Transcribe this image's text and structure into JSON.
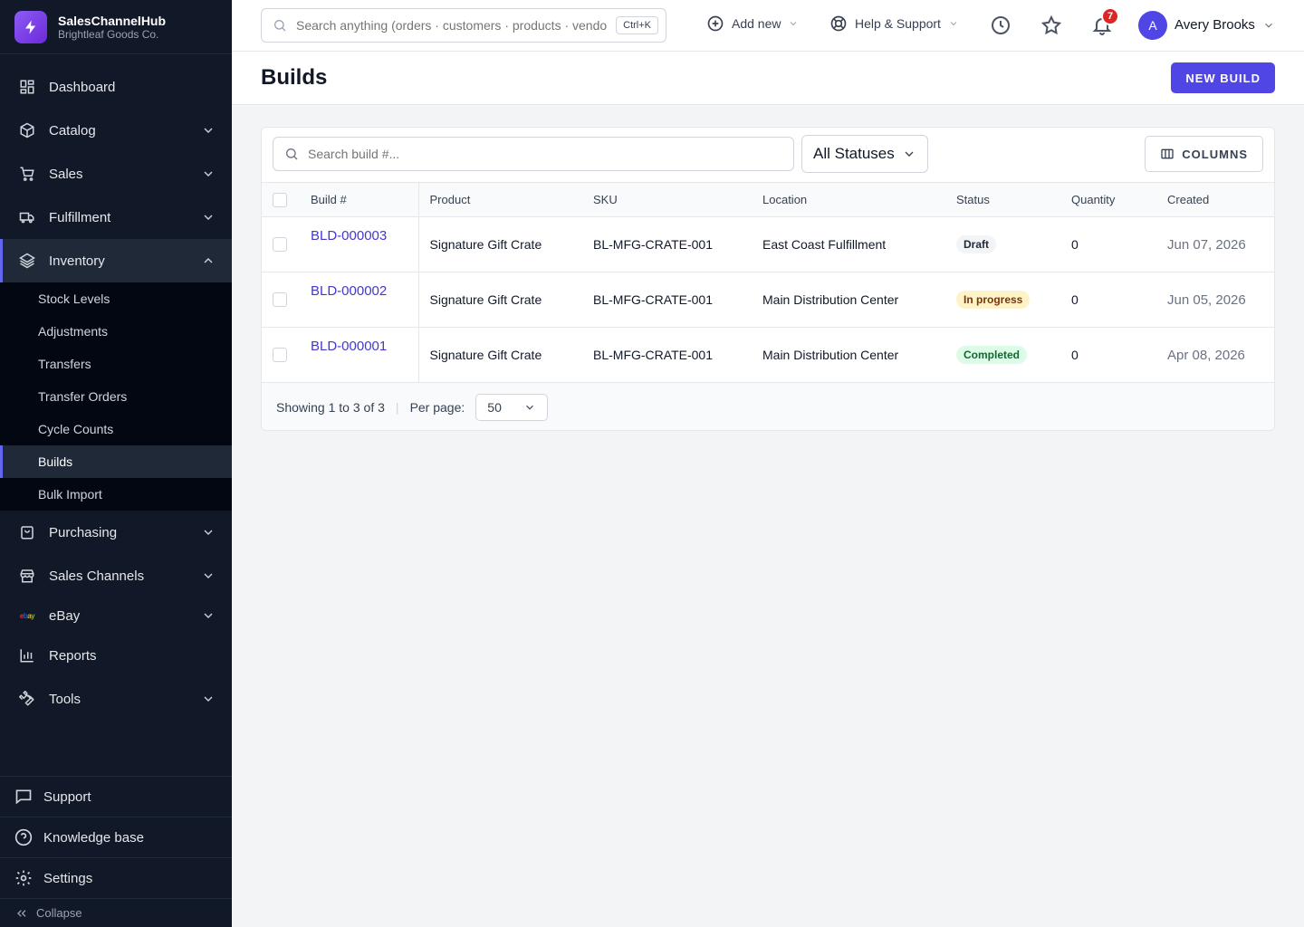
{
  "brand": {
    "name": "SalesChannelHub",
    "company": "Brightleaf Goods Co."
  },
  "sidebar": {
    "items": [
      {
        "label": "Dashboard",
        "icon": "dashboard-icon"
      },
      {
        "label": "Catalog",
        "icon": "box-icon"
      },
      {
        "label": "Sales",
        "icon": "cart-icon"
      },
      {
        "label": "Fulfillment",
        "icon": "truck-icon"
      },
      {
        "label": "Inventory",
        "icon": "layers-icon"
      },
      {
        "label": "Purchasing",
        "icon": "bag-icon"
      },
      {
        "label": "Sales Channels",
        "icon": "store-icon"
      },
      {
        "label": "eBay",
        "icon": "ebay-icon"
      },
      {
        "label": "Reports",
        "icon": "chart-icon"
      },
      {
        "label": "Tools",
        "icon": "wrench-icon"
      }
    ],
    "inventory_sub": [
      "Stock Levels",
      "Adjustments",
      "Transfers",
      "Transfer Orders",
      "Cycle Counts",
      "Builds",
      "Bulk Import"
    ],
    "active_sub": "Builds",
    "bottom": {
      "support": "Support",
      "knowledge": "Knowledge base",
      "settings": "Settings",
      "collapse": "Collapse"
    }
  },
  "topbar": {
    "search_placeholder": "Search anything (orders · customers · products · vendors)",
    "shortcut": "Ctrl+K",
    "add_new": "Add new",
    "help": "Help & Support",
    "notifications": "7",
    "avatar_initial": "A",
    "user": "Avery Brooks"
  },
  "page": {
    "title": "Builds",
    "new_button": "NEW BUILD"
  },
  "toolbar": {
    "search_placeholder": "Search build #...",
    "status_filter": "All Statuses",
    "columns": "COLUMNS"
  },
  "table": {
    "headers": [
      "Build #",
      "Product",
      "SKU",
      "Location",
      "Status",
      "Quantity",
      "Created"
    ],
    "rows": [
      {
        "build": "BLD-000003",
        "product": "Signature Gift Crate",
        "sku": "BL-MFG-CRATE-001",
        "location": "East Coast Fulfillment",
        "status": "Draft",
        "quantity": "0",
        "created": "Jun 07, 2026"
      },
      {
        "build": "BLD-000002",
        "product": "Signature Gift Crate",
        "sku": "BL-MFG-CRATE-001",
        "location": "Main Distribution Center",
        "status": "In progress",
        "quantity": "0",
        "created": "Jun 05, 2026"
      },
      {
        "build": "BLD-000001",
        "product": "Signature Gift Crate",
        "sku": "BL-MFG-CRATE-001",
        "location": "Main Distribution Center",
        "status": "Completed",
        "quantity": "0",
        "created": "Apr 08, 2026"
      }
    ]
  },
  "footer": {
    "showing_prefix": "Showing",
    "from": "1",
    "to_word": "to",
    "to": "3",
    "of_word": "of",
    "total": "3",
    "per_page_label": "Per page:",
    "per_page": "50"
  },
  "colors": {
    "accent": "#4f46e5",
    "sidebar_bg": "#111827",
    "notification": "#dc2626"
  }
}
